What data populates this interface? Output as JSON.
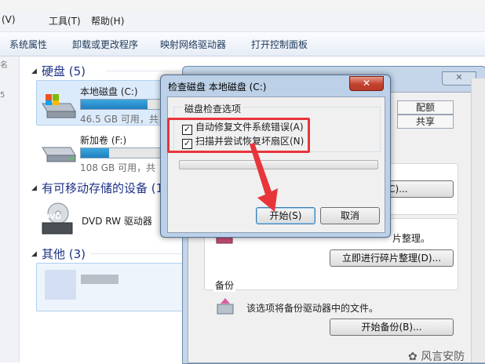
{
  "menubar": {
    "items": [
      "(V)",
      "工具(T)",
      "帮助(H)"
    ]
  },
  "commandbar": {
    "items": [
      "系统属性",
      "卸载或更改程序",
      "映射网络驱动器",
      "打开控制面板"
    ]
  },
  "nav_scraps": [
    "名",
    "",
    "5"
  ],
  "groups": {
    "hdd": {
      "title": "硬盘 (5)"
    },
    "removable": {
      "title": "有可移动存储的设备 (1"
    },
    "other": {
      "title": "其他 (3)"
    }
  },
  "drives": {
    "c": {
      "name": "本地磁盘 (C:)",
      "sub": "46.5 GB 可用，共",
      "usage": 0.65
    },
    "f": {
      "name": "新加卷 (F:)",
      "sub": "108 GB 可用，共",
      "usage": 0.28
    },
    "dvd": {
      "name": "DVD RW 驱动器",
      "badge": "DVD"
    }
  },
  "properties": {
    "tabs": {
      "quota": "配额",
      "share": "共享"
    },
    "check_button": "查(C)...",
    "defrag_text": "片整理。",
    "defrag_button": "立即进行碎片整理(D)...",
    "backup_label": "备份",
    "backup_text": "该选项将备份驱动器中的文件。",
    "backup_button": "开始备份(B)..."
  },
  "dialog": {
    "title": "检查磁盘 本地磁盘 (C:)",
    "close": "✕",
    "group_label": "磁盘检查选项",
    "option1": "自动修复文件系统错误(A)",
    "option2": "扫描并尝试恢复坏扇区(N)",
    "option1_checked": "✓",
    "option2_checked": "✓",
    "start_button": "开始(S)",
    "cancel_button": "取消"
  },
  "watermark": "风言安防",
  "colors": {
    "highlight": "#e8353a",
    "accent": "#1e3287",
    "bar": "#2b93d1"
  }
}
